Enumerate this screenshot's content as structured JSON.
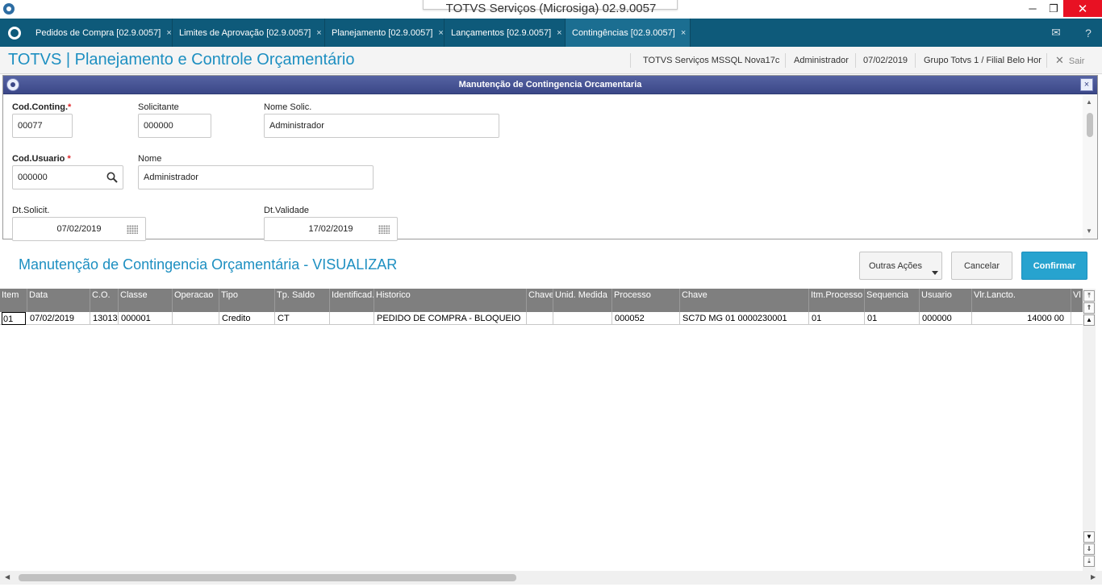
{
  "os": {
    "title": "TOTVS Serviços (Microsiga) 02.9.0057",
    "minimize": "─",
    "maximize": "❐",
    "close": "✕"
  },
  "tabs": [
    {
      "label": "Pedidos de Compra [02.9.0057]",
      "close": "×"
    },
    {
      "label": "Limites de Aprovação [02.9.0057]",
      "close": "×"
    },
    {
      "label": "Planejamento [02.9.0057]",
      "close": "×"
    },
    {
      "label": "Lançamentos [02.9.0057]",
      "close": "×"
    },
    {
      "label": "Contingências [02.9.0057]",
      "close": "×"
    }
  ],
  "tabbar_icons": {
    "mail": "✉",
    "help": "?"
  },
  "header": {
    "title": "TOTVS | Planejamento e Controle Orçamentário",
    "environment": "TOTVS Serviços MSSQL Nova17c",
    "user": "Administrador",
    "date": "07/02/2019",
    "branch": "Grupo Totvs 1 / Filial Belo Hor",
    "exit_label": "Sair",
    "exit_icon": "✕"
  },
  "dialog": {
    "title": "Manutenção de Contingencia Orcamentaria",
    "close_label": "×",
    "fields": {
      "cod_conting": {
        "label": "Cod.Conting.",
        "value": "00077",
        "required": "*"
      },
      "solicitante": {
        "label": "Solicitante",
        "value": "000000"
      },
      "nome_solic": {
        "label": "Nome Solic.",
        "value": "Administrador"
      },
      "cod_usuario": {
        "label": "Cod.Usuario ",
        "value": "000000",
        "required": "*"
      },
      "nome": {
        "label": "Nome",
        "value": "Administrador"
      },
      "dt_solicit": {
        "label": "Dt.Solicit.",
        "value": "07/02/2019"
      },
      "dt_validade": {
        "label": "Dt.Validade",
        "value": "17/02/2019"
      }
    }
  },
  "section": {
    "title": "Manutenção de Contingencia Orçamentária - VISUALIZAR",
    "buttons": {
      "outras": "Outras Ações",
      "cancel": "Cancelar",
      "confirm": "Confirmar"
    }
  },
  "grid": {
    "columns": [
      "Item",
      "Data",
      "C.O.",
      "Classe",
      "Operacao",
      "Tipo",
      "Tp. Saldo",
      "Identificad.",
      "Historico",
      "Chave",
      "Unid. Medida",
      "Processo",
      "Chave",
      "Itm.Processo",
      "Sequencia",
      "Usuario",
      "Vlr.Lancto.",
      "Vl"
    ],
    "rows": [
      [
        "01",
        "07/02/2019",
        "13013",
        "000001",
        "",
        "Credito",
        "CT",
        "",
        "PEDIDO DE COMPRA - BLOQUEIO",
        "",
        "",
        "000052",
        "SC7D MG 01 0000230001",
        "01",
        "01",
        "000000",
        "14000 00",
        ""
      ]
    ]
  },
  "colors": {
    "accent": "#1d8fc1",
    "tabbar": "#0e5a7a",
    "dialog_title": "#3b4788",
    "confirm": "#27a3cf",
    "required": "#e0262a"
  }
}
